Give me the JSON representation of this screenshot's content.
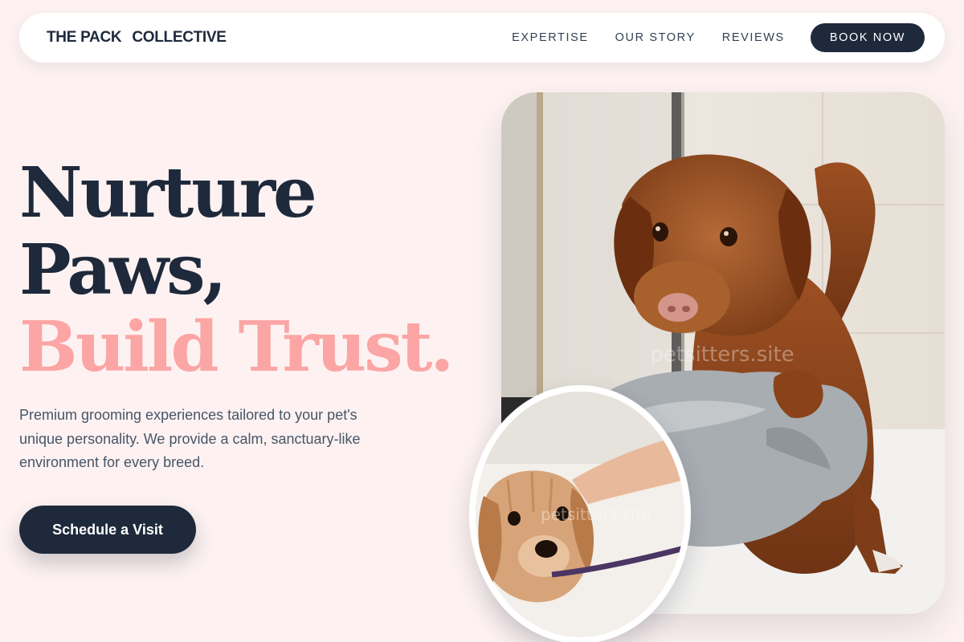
{
  "brand": {
    "word1": "THE PACK",
    "word2": "COLLECTIVE"
  },
  "nav": {
    "links": [
      "EXPERTISE",
      "OUR STORY",
      "REVIEWS"
    ],
    "cta": "BOOK NOW"
  },
  "hero": {
    "headline_line1": "Nurture",
    "headline_line2": "Paws,",
    "headline_accent": "Build Trust.",
    "subtitle": "Premium grooming experiences tailored to your pet's unique personality. We provide a calm, sanctuary-like environment for every breed.",
    "cta": "Schedule a Visit"
  },
  "photos": {
    "main_watermark": "petsitters.site",
    "small_watermark": "petsitters.site"
  },
  "colors": {
    "background": "#fdf2f1",
    "navy": "#1e293b",
    "accent_pink": "#fca5a5",
    "body_text": "#475569"
  }
}
